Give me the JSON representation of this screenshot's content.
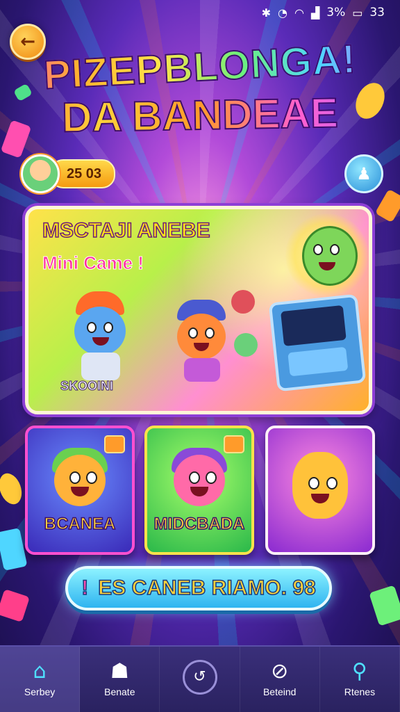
{
  "status": {
    "bluetooth": "✱",
    "signal_text": "3%",
    "time": "33"
  },
  "title": {
    "line1": "PIZEPBLONGA!",
    "line2": "DA BANDEAE"
  },
  "player": {
    "coins": "25 03"
  },
  "featured": {
    "title": "MSCTAJI ANEBE",
    "subtitle": "Mini Came !",
    "character_name": "SKOOINI"
  },
  "tiles": [
    {
      "label": "BCANEA"
    },
    {
      "label": "MIDCBADA"
    },
    {
      "label": ""
    }
  ],
  "play_button": {
    "icon": "!",
    "label": "ES CANEB RIAMO. 98"
  },
  "tabs": [
    {
      "label": "Serbey",
      "icon": "home-icon"
    },
    {
      "label": "Benate",
      "icon": "ghost-icon"
    },
    {
      "label": "",
      "icon": "dial-icon"
    },
    {
      "label": "Beteind",
      "icon": "compass-icon"
    },
    {
      "label": "Rtenes",
      "icon": "search-icon"
    }
  ],
  "colors": {
    "accent": "#ff9b2a",
    "play_button": "#2fb4f0",
    "tabbar": "#2a2260"
  }
}
